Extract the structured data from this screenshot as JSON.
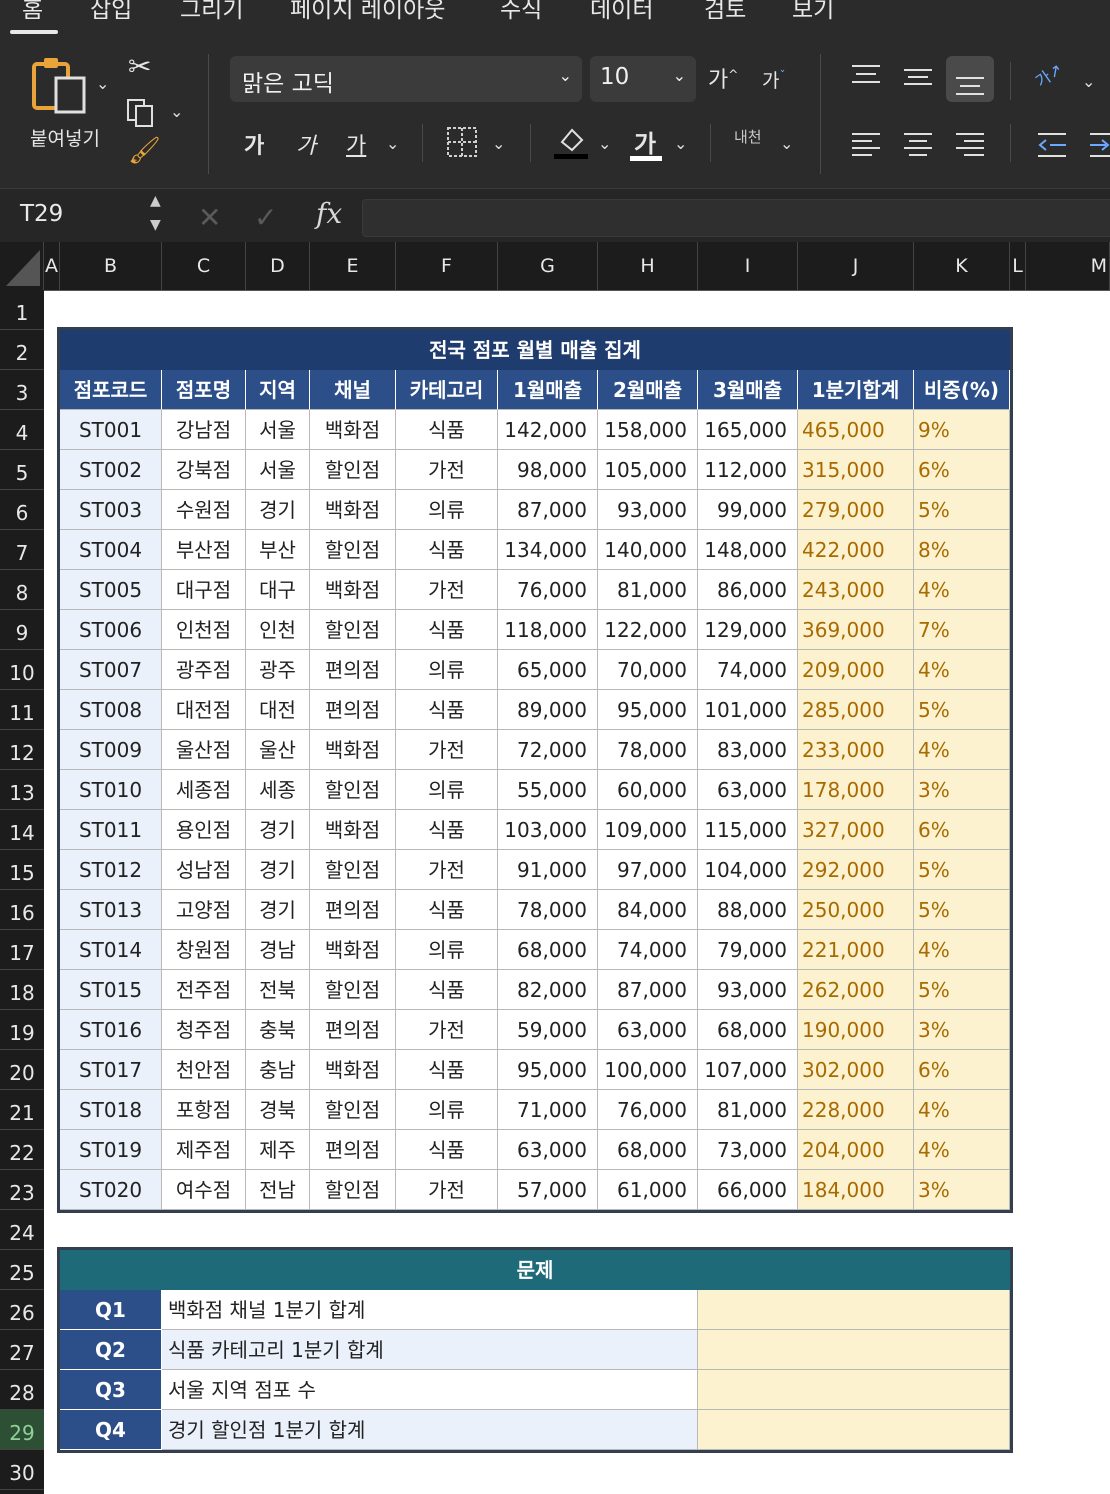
{
  "ribbon": {
    "tabs": [
      "홈",
      "삽입",
      "그리기",
      "페이지 레이아웃",
      "수식",
      "데이터",
      "검토",
      "보기"
    ],
    "paste_label": "붙여넣기",
    "font_name": "맑은 고딕",
    "font_size": "10",
    "grow_font": "가",
    "shrink_font": "가",
    "bold": "가",
    "italic": "가",
    "underline": "가",
    "font_color_glyph": "가",
    "wrap_label": "내천",
    "orientation_glyph": "가"
  },
  "formula_bar": {
    "name_box": "T29",
    "fx": "fx",
    "formula": ""
  },
  "columns": [
    "A",
    "B",
    "C",
    "D",
    "E",
    "F",
    "G",
    "H",
    "I",
    "J",
    "K",
    "L",
    "M"
  ],
  "rows": [
    "1",
    "2",
    "3",
    "4",
    "5",
    "6",
    "7",
    "8",
    "9",
    "10",
    "11",
    "12",
    "13",
    "14",
    "15",
    "16",
    "17",
    "18",
    "19",
    "20",
    "21",
    "22",
    "23",
    "24",
    "25",
    "26",
    "27",
    "28",
    "29",
    "30"
  ],
  "sales_table": {
    "title": "전국 점포 월별 매출 집계",
    "headers": [
      "점포코드",
      "점포명",
      "지역",
      "채널",
      "카테고리",
      "1월매출",
      "2월매출",
      "3월매출",
      "1분기합계",
      "비중(%)"
    ],
    "rows": [
      [
        "ST001",
        "강남점",
        "서울",
        "백화점",
        "식품",
        "142,000",
        "158,000",
        "165,000",
        "465,000",
        "9%"
      ],
      [
        "ST002",
        "강북점",
        "서울",
        "할인점",
        "가전",
        "98,000",
        "105,000",
        "112,000",
        "315,000",
        "6%"
      ],
      [
        "ST003",
        "수원점",
        "경기",
        "백화점",
        "의류",
        "87,000",
        "93,000",
        "99,000",
        "279,000",
        "5%"
      ],
      [
        "ST004",
        "부산점",
        "부산",
        "할인점",
        "식품",
        "134,000",
        "140,000",
        "148,000",
        "422,000",
        "8%"
      ],
      [
        "ST005",
        "대구점",
        "대구",
        "백화점",
        "가전",
        "76,000",
        "81,000",
        "86,000",
        "243,000",
        "4%"
      ],
      [
        "ST006",
        "인천점",
        "인천",
        "할인점",
        "식품",
        "118,000",
        "122,000",
        "129,000",
        "369,000",
        "7%"
      ],
      [
        "ST007",
        "광주점",
        "광주",
        "편의점",
        "의류",
        "65,000",
        "70,000",
        "74,000",
        "209,000",
        "4%"
      ],
      [
        "ST008",
        "대전점",
        "대전",
        "편의점",
        "식품",
        "89,000",
        "95,000",
        "101,000",
        "285,000",
        "5%"
      ],
      [
        "ST009",
        "울산점",
        "울산",
        "백화점",
        "가전",
        "72,000",
        "78,000",
        "83,000",
        "233,000",
        "4%"
      ],
      [
        "ST010",
        "세종점",
        "세종",
        "할인점",
        "의류",
        "55,000",
        "60,000",
        "63,000",
        "178,000",
        "3%"
      ],
      [
        "ST011",
        "용인점",
        "경기",
        "백화점",
        "식품",
        "103,000",
        "109,000",
        "115,000",
        "327,000",
        "6%"
      ],
      [
        "ST012",
        "성남점",
        "경기",
        "할인점",
        "가전",
        "91,000",
        "97,000",
        "104,000",
        "292,000",
        "5%"
      ],
      [
        "ST013",
        "고양점",
        "경기",
        "편의점",
        "식품",
        "78,000",
        "84,000",
        "88,000",
        "250,000",
        "5%"
      ],
      [
        "ST014",
        "창원점",
        "경남",
        "백화점",
        "의류",
        "68,000",
        "74,000",
        "79,000",
        "221,000",
        "4%"
      ],
      [
        "ST015",
        "전주점",
        "전북",
        "할인점",
        "식품",
        "82,000",
        "87,000",
        "93,000",
        "262,000",
        "5%"
      ],
      [
        "ST016",
        "청주점",
        "충북",
        "편의점",
        "가전",
        "59,000",
        "63,000",
        "68,000",
        "190,000",
        "3%"
      ],
      [
        "ST017",
        "천안점",
        "충남",
        "백화점",
        "식품",
        "95,000",
        "100,000",
        "107,000",
        "302,000",
        "6%"
      ],
      [
        "ST018",
        "포항점",
        "경북",
        "할인점",
        "의류",
        "71,000",
        "76,000",
        "81,000",
        "228,000",
        "4%"
      ],
      [
        "ST019",
        "제주점",
        "제주",
        "편의점",
        "식품",
        "63,000",
        "68,000",
        "73,000",
        "204,000",
        "4%"
      ],
      [
        "ST020",
        "여수점",
        "전남",
        "할인점",
        "가전",
        "57,000",
        "61,000",
        "66,000",
        "184,000",
        "3%"
      ]
    ]
  },
  "questions": {
    "title": "문제",
    "items": [
      {
        "id": "Q1",
        "text": "백화점 채널 1분기 합계",
        "answer": ""
      },
      {
        "id": "Q2",
        "text": "식품 카테고리 1분기 합계",
        "answer": ""
      },
      {
        "id": "Q3",
        "text": "서울 지역 점포 수",
        "answer": ""
      },
      {
        "id": "Q4",
        "text": "경기 할인점 1분기 합계",
        "answer": ""
      }
    ]
  },
  "colors": {
    "header_blue": "#2c4f8a",
    "title_navy": "#1f3c6e",
    "question_teal": "#1e6a78",
    "row_alt": "#eaf1fb",
    "sum_fill": "#fdf2cf",
    "sum_text": "#a86a00"
  }
}
